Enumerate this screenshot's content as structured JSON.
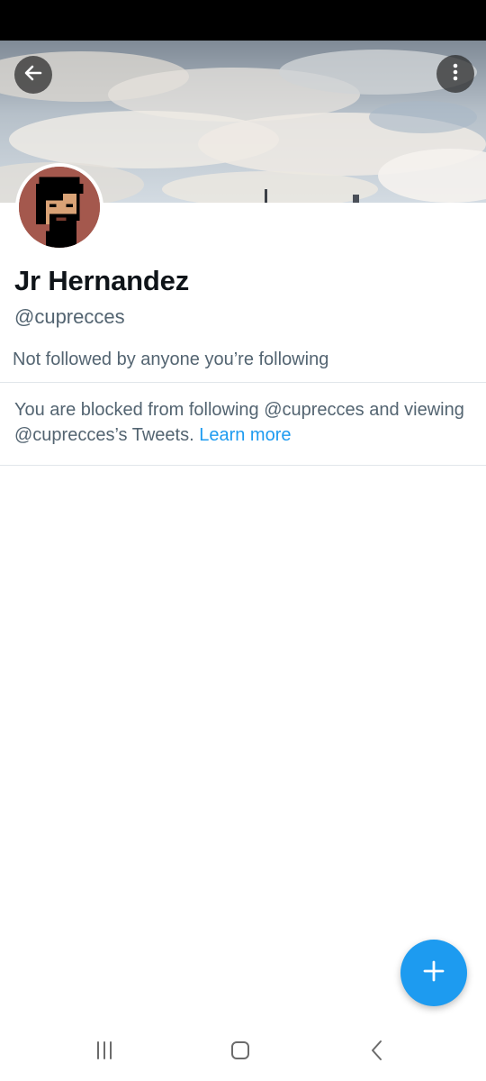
{
  "header": {
    "back_icon": "arrow-left-icon",
    "more_icon": "more-vertical-icon"
  },
  "profile": {
    "display_name": "Jr Hernandez",
    "handle": "@cuprecces",
    "followers_note": "Not followed by anyone you’re following"
  },
  "blocked": {
    "message": "You are blocked from following @cuprecces and viewing @cuprecces’s Tweets.",
    "link_label": "Learn more"
  },
  "fab": {
    "icon": "plus-icon"
  },
  "system_nav": {
    "recent_icon": "recent-apps-icon",
    "home_icon": "home-icon",
    "back_icon": "back-chevron-icon"
  },
  "colors": {
    "accent": "#1d9bf0",
    "secondary_text": "#536471",
    "primary_text": "#0f1419",
    "avatar_bg": "#a4584d"
  }
}
